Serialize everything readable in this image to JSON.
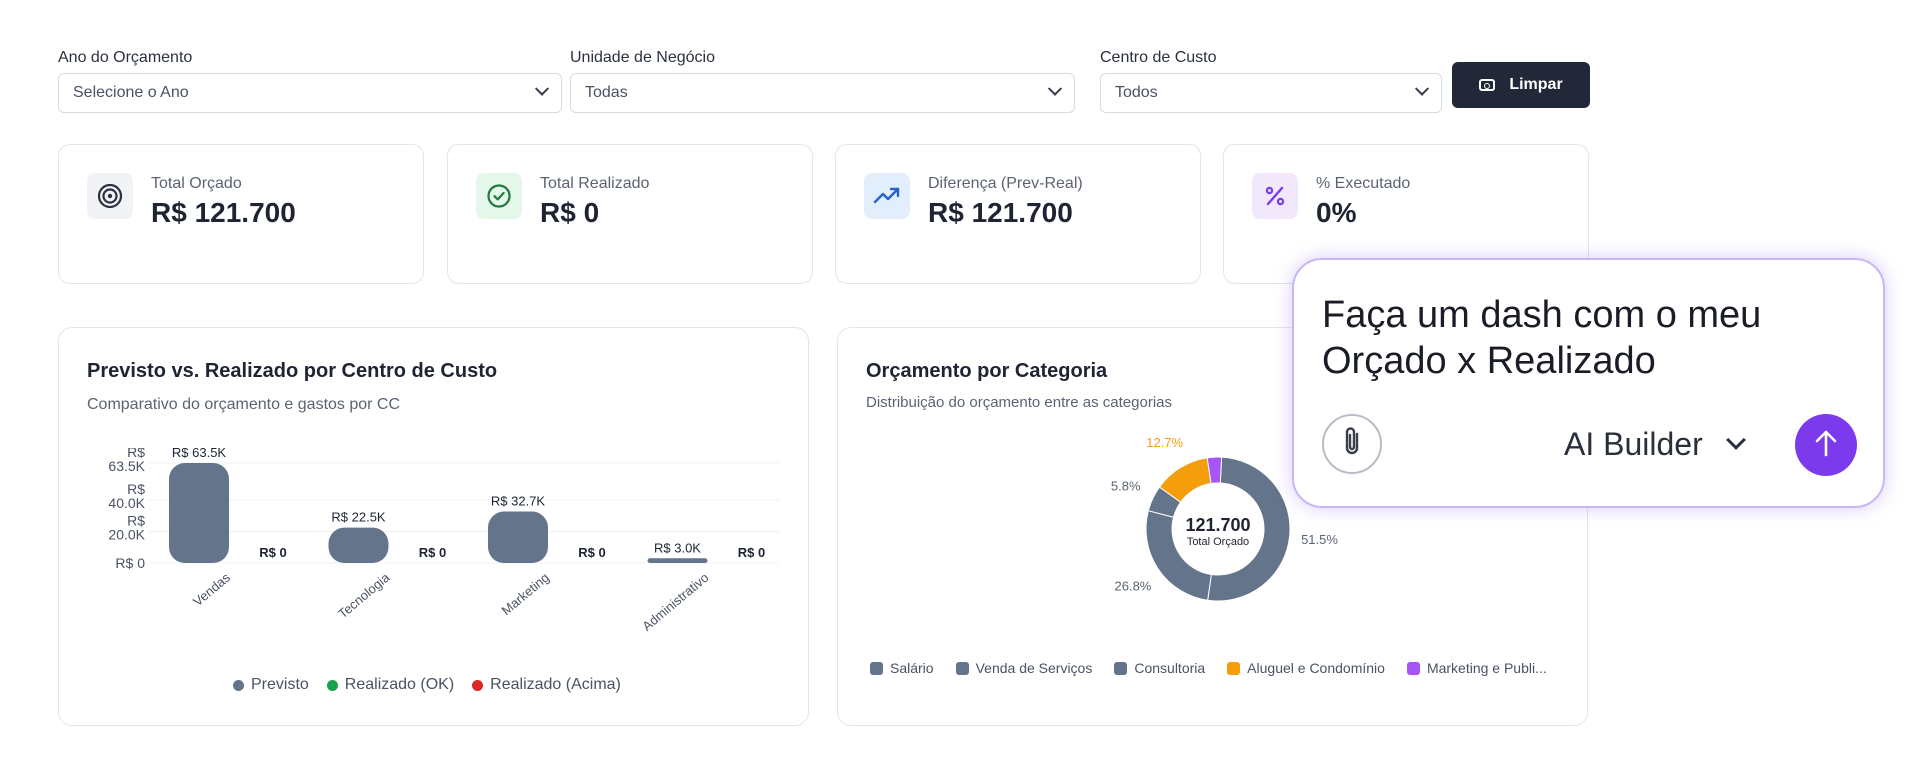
{
  "filters": {
    "year": {
      "label": "Ano do Orçamento",
      "value": "Selecione o Ano"
    },
    "business_unit": {
      "label": "Unidade de Negócio",
      "value": "Todas"
    },
    "cost_center": {
      "label": "Centro de Custo",
      "value": "Todos"
    },
    "clear_label": "Limpar"
  },
  "kpis": [
    {
      "label": "Total Orçado",
      "value": "R$ 121.700",
      "icon": "target-icon",
      "bg": "#f1f3f6",
      "color": "#2b3140"
    },
    {
      "label": "Total Realizado",
      "value": "R$ 0",
      "icon": "check-circle-icon",
      "bg": "#e5f6ea",
      "color": "#1f7a3d"
    },
    {
      "label": "Diferença (Prev-Real)",
      "value": "R$ 121.700",
      "icon": "trending-up-icon",
      "bg": "#e3eefc",
      "color": "#2563c9"
    },
    {
      "label": "% Executado",
      "value": "0%",
      "icon": "percent-icon",
      "bg": "#f1e8fc",
      "color": "#7c3aed"
    }
  ],
  "bar_card": {
    "title": "Previsto vs. Realizado por Centro de Custo",
    "subtitle": "Comparativo do orçamento e gastos por CC",
    "legend": [
      {
        "label": "Previsto",
        "color": "#64748b"
      },
      {
        "label": "Realizado (OK)",
        "color": "#16a34a"
      },
      {
        "label": "Realizado (Acima)",
        "color": "#dc2626"
      }
    ]
  },
  "pie_card": {
    "title": "Orçamento por Categoria",
    "subtitle": "Distribuição do orçamento entre as categorias",
    "center_value": "121.700",
    "center_label": "Total Orçado",
    "legend": [
      {
        "label": "Salário",
        "color": "#64748b"
      },
      {
        "label": "Venda de Serviços",
        "color": "#64748b"
      },
      {
        "label": "Consultoria",
        "color": "#64748b"
      },
      {
        "label": "Aluguel e Condomínio",
        "color": "#f59e0b"
      },
      {
        "label": "Marketing e Publi...",
        "color": "#a855f7"
      }
    ]
  },
  "chat": {
    "prompt": "Faça um dash com o meu Orçado x Realizado",
    "model": "AI Builder",
    "attach_icon": "paperclip-icon",
    "send_icon": "arrow-up-icon",
    "accent": "#7c3aed"
  },
  "chart_data": [
    {
      "type": "bar",
      "categories": [
        "Vendas",
        "Tecnologia",
        "Marketing",
        "Administrativo"
      ],
      "series": [
        {
          "name": "Previsto",
          "values": [
            63500,
            22500,
            32700,
            3000
          ],
          "labels": [
            "R$ 63.5K",
            "R$ 22.5K",
            "R$ 32.7K",
            "R$ 3.0K"
          ]
        },
        {
          "name": "Realizado (OK)",
          "values": [
            0,
            0,
            0,
            0
          ],
          "labels": [
            "R$ 0",
            "R$ 0",
            "R$ 0",
            "R$ 0"
          ]
        }
      ],
      "yticks": [
        "R$ 0",
        "R$ 20.0K",
        "R$ 40.0K",
        "R$ 63.5K"
      ],
      "ytick_values": [
        0,
        20000,
        40000,
        63500
      ],
      "ylim": [
        0,
        63500
      ],
      "grid": true,
      "legend": "bottom"
    },
    {
      "type": "pie",
      "labels": [
        "Salário",
        "Venda de Serviços",
        "Consultoria",
        "Aluguel e Condomínio",
        "Marketing e Publi..."
      ],
      "values": [
        51.5,
        26.8,
        5.8,
        12.7,
        3.2
      ],
      "shown_labels": [
        "51.5%",
        "26.8%",
        "5.8%",
        "12.7%",
        ""
      ],
      "colors": [
        "#64748b",
        "#64748b",
        "#64748b",
        "#f59e0b",
        "#a855f7"
      ],
      "legend": "bottom"
    }
  ]
}
